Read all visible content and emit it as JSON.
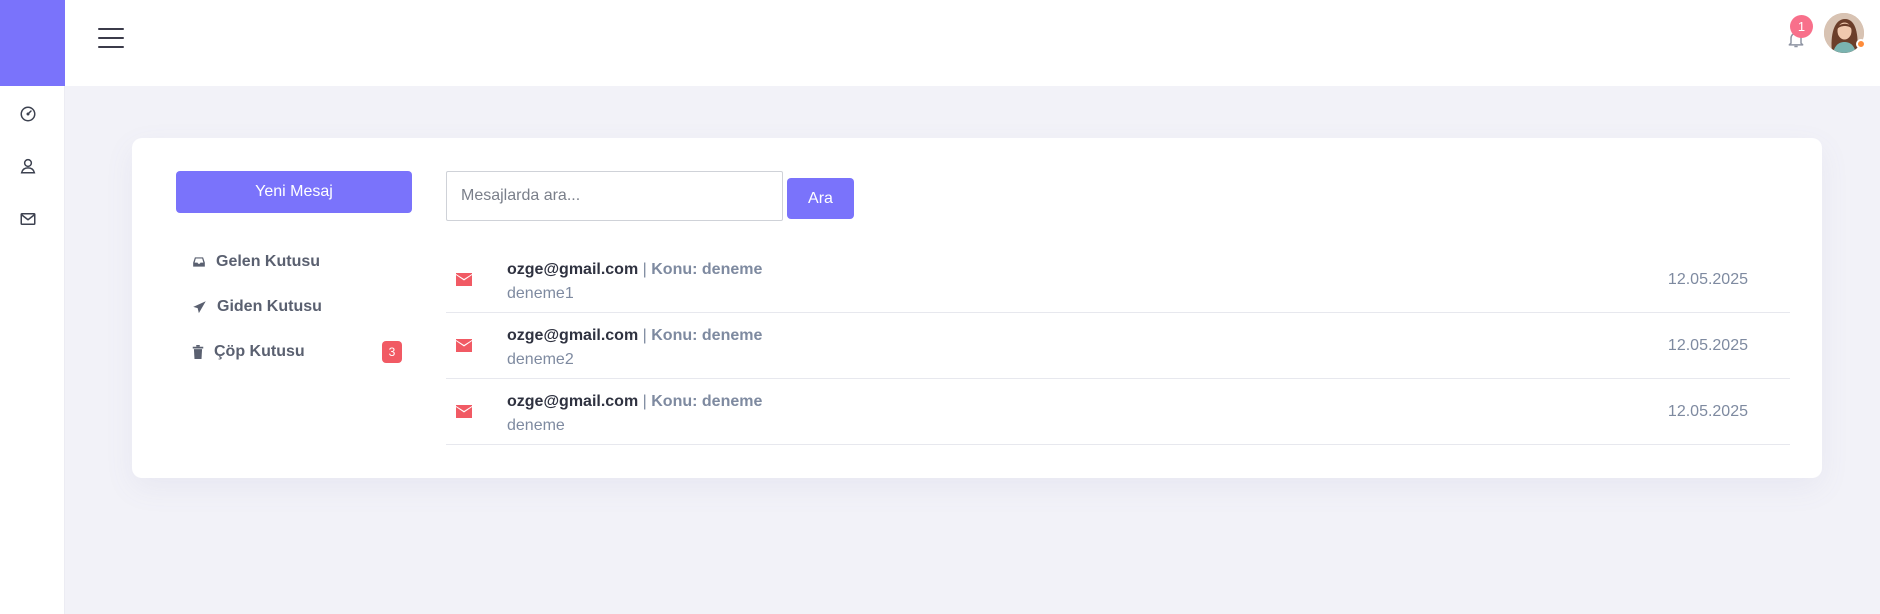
{
  "sidebar": {
    "items": [
      {
        "icon": "dashboard-gauge-icon"
      },
      {
        "icon": "user-icon"
      },
      {
        "icon": "mail-icon"
      }
    ]
  },
  "topbar": {
    "notification_count": "1",
    "status_color": "#ff8c3a"
  },
  "mail": {
    "new_message_label": "Yeni Mesaj",
    "folders": [
      {
        "label": "Gelen Kutusu",
        "icon": "inbox-icon"
      },
      {
        "label": "Giden Kutusu",
        "icon": "paper-plane-icon"
      },
      {
        "label": "Çöp Kutusu",
        "icon": "trash-icon",
        "badge": "3"
      }
    ],
    "search": {
      "placeholder": "Mesajlarda ara...",
      "button_label": "Ara"
    },
    "messages": [
      {
        "sender": "ozge@gmail.com",
        "separator": "|",
        "subject": "Konu: deneme",
        "preview": "deneme1",
        "date": "12.05.2025"
      },
      {
        "sender": "ozge@gmail.com",
        "separator": "|",
        "subject": "Konu: deneme",
        "preview": "deneme2",
        "date": "12.05.2025"
      },
      {
        "sender": "ozge@gmail.com",
        "separator": "|",
        "subject": "Konu: deneme",
        "preview": "deneme",
        "date": "12.05.2025"
      }
    ]
  },
  "colors": {
    "accent": "#7a73fb",
    "danger": "#f15a64",
    "notification": "#f8708b",
    "muted_text": "#7e8aa0",
    "background": "#f2f2f8"
  }
}
